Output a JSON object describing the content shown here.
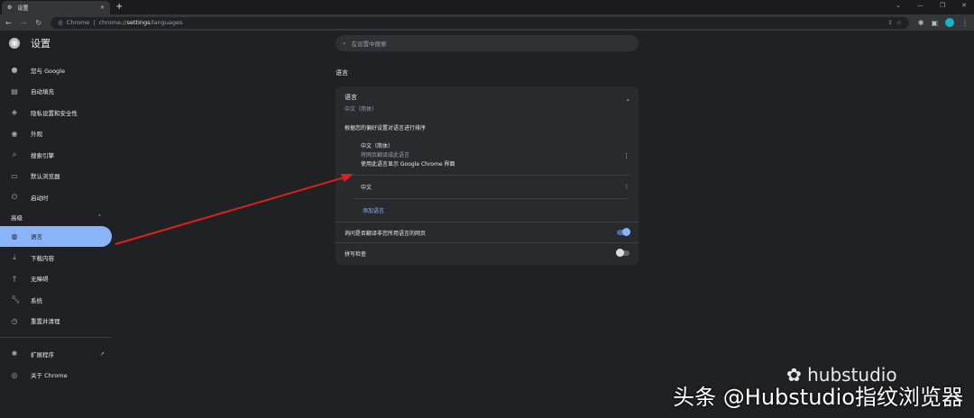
{
  "tab": {
    "title": "设置"
  },
  "address": {
    "site": "Chrome",
    "url_prefix": "chrome://",
    "url_bold": "settings",
    "url_suffix": "/languages"
  },
  "header": {
    "title": "设置",
    "search_placeholder": "在设置中搜索"
  },
  "sidebar": {
    "items": [
      {
        "label": "您与 Google",
        "icon": "person"
      },
      {
        "label": "自动填充",
        "icon": "clipboard"
      },
      {
        "label": "隐私设置和安全性",
        "icon": "shield"
      },
      {
        "label": "外观",
        "icon": "palette"
      },
      {
        "label": "搜索引擎",
        "icon": "search"
      },
      {
        "label": "默认浏览器",
        "icon": "browser"
      },
      {
        "label": "启动时",
        "icon": "power"
      }
    ],
    "advanced_label": "高级",
    "advanced_items": [
      {
        "label": "语言",
        "icon": "globe",
        "active": true
      },
      {
        "label": "下载内容",
        "icon": "download"
      },
      {
        "label": "无障碍",
        "icon": "accessibility"
      },
      {
        "label": "系统",
        "icon": "wrench"
      },
      {
        "label": "重置并清理",
        "icon": "restore"
      }
    ],
    "extensions": "扩展程序",
    "about": "关于 Chrome"
  },
  "main": {
    "heading": "语言",
    "card": {
      "title": "语言",
      "subtitle": "中文（简体）",
      "order_label": "根据您的偏好设置对语言进行排序",
      "languages": [
        {
          "name": "中文（简体）",
          "line1": "将网页翻译成此语言",
          "line2": "使用此语言显示 Google Chrome 界面"
        },
        {
          "name": "中文"
        }
      ],
      "add_language": "添加语言",
      "translate_label": "询问是否翻译非您所用语言的网页",
      "translate_on": true,
      "spellcheck_label": "拼写检查",
      "spellcheck_on": false
    }
  },
  "watermark": {
    "brand": "hubstudio",
    "credit": "头条 @Hubstudio指纹浏览器"
  },
  "colors": {
    "accent": "#8ab4f8",
    "bg": "#202124",
    "card": "#292a2d",
    "arrow": "#e0201c"
  }
}
